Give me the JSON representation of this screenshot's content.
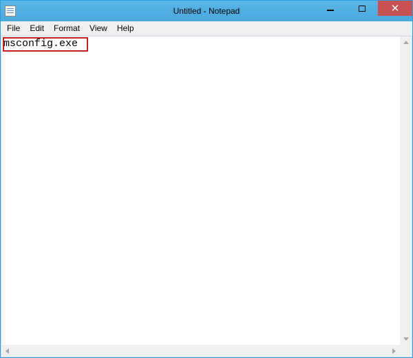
{
  "window": {
    "title": "Untitled - Notepad"
  },
  "menu": {
    "items": [
      "File",
      "Edit",
      "Format",
      "View",
      "Help"
    ]
  },
  "editor": {
    "content": "msconfig.exe"
  }
}
